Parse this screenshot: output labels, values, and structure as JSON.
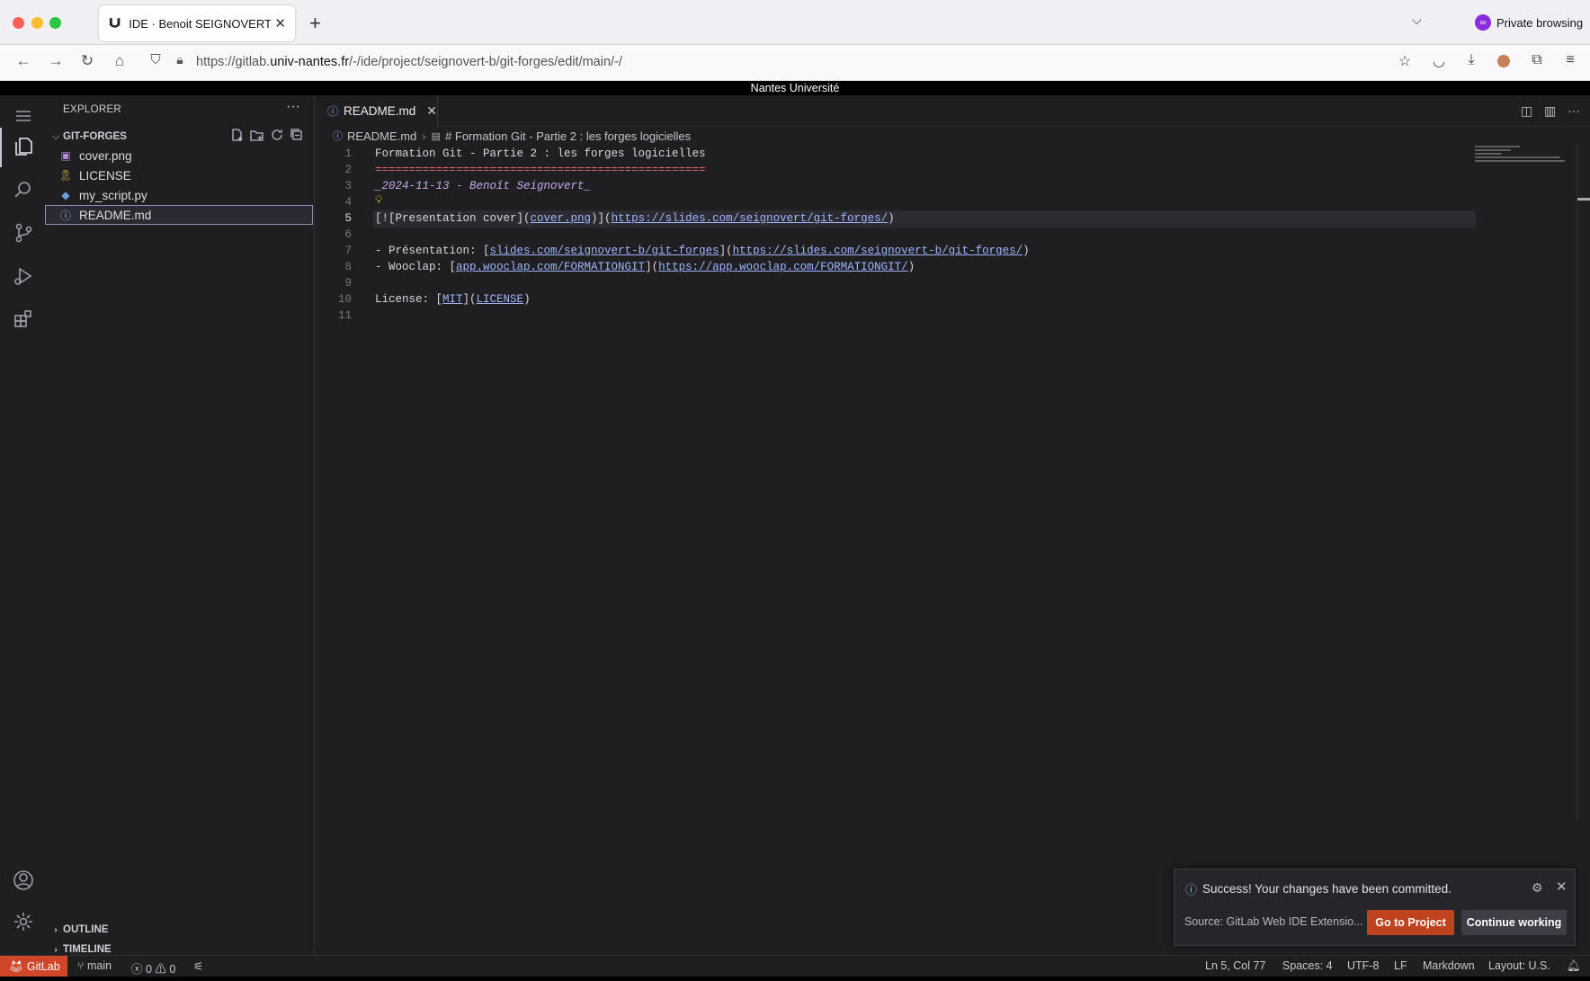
{
  "browser": {
    "tab_title": "IDE · Benoit SEIGNOVERT / Form",
    "private_label": "Private browsing",
    "url_prefix": "https://gitlab.",
    "url_domain": "univ-nantes.fr",
    "url_path": "/-/ide/project/seignovert-b/git-forges/edit/main/-/",
    "banner": "Nantes Université"
  },
  "sidebar": {
    "title": "EXPLORER",
    "project": "GIT-FORGES",
    "files": [
      {
        "name": "cover.png",
        "icon": "image-icon"
      },
      {
        "name": "LICENSE",
        "icon": "license-icon"
      },
      {
        "name": "my_script.py",
        "icon": "python-icon"
      },
      {
        "name": "README.md",
        "icon": "info-icon",
        "selected": true
      }
    ],
    "outline": "OUTLINE",
    "timeline": "TIMELINE"
  },
  "editor": {
    "tab": "README.md",
    "breadcrumb_file": "README.md",
    "breadcrumb_symbol": "# Formation Git - Partie 2 : les forges logicielles",
    "line_numbers": [
      "1",
      "2",
      "3",
      "4",
      "5",
      "6",
      "7",
      "8",
      "9",
      "10",
      "11"
    ],
    "lines": {
      "l1": "Formation Git - Partie 2 : les forges logicielles",
      "l2": "=================================================",
      "l3": "_2024-11-13 - Benoît Seignovert_",
      "l5a": "[![Presentation cover](",
      "l5b": "cover.png",
      "l5c": ")](",
      "l5d": "https://slides.com/seignovert/git-forges/",
      "l5e": ")",
      "l7a": "- Présentation: [",
      "l7b": "slides.com/seignovert-b/git-forges",
      "l7c": "](",
      "l7d": "https://slides.com/seignovert-b/git-forges/",
      "l7e": ")",
      "l8a": "- Wooclap: [",
      "l8b": "app.wooclap.com/FORMATIONGIT",
      "l8c": "](",
      "l8d": "https://app.wooclap.com/FORMATIONGIT/",
      "l8e": ")",
      "l10a": "License: [",
      "l10b": "MIT",
      "l10c": "](",
      "l10d": "LICENSE",
      "l10e": ")"
    }
  },
  "notification": {
    "message": "Success! Your changes have been committed.",
    "source": "Source: GitLab Web IDE Extensio...",
    "primary_button": "Go to Project",
    "secondary_button": "Continue working"
  },
  "statusbar": {
    "gitlab": "GitLab",
    "branch": "main",
    "errors": "0",
    "warnings": "0",
    "position": "Ln 5, Col 77",
    "spaces": "Spaces: 4",
    "encoding": "UTF-8",
    "eol": "LF",
    "language": "Markdown",
    "layout": "Layout: U.S."
  },
  "colors": {
    "accent_gitlab": "#d0462a",
    "go_button": "#c0431f",
    "link": "#9fb6ff",
    "heading_rule": "#ef6a6a"
  }
}
